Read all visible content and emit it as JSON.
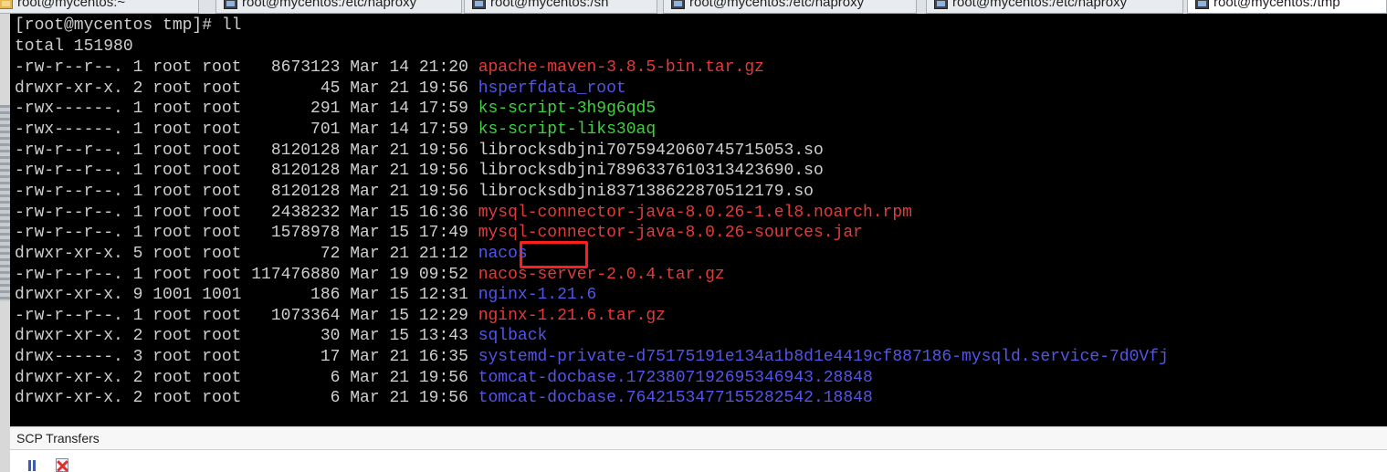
{
  "tabs": [
    {
      "label": "root@mycentos:~",
      "active": false,
      "icon": "folder-terminal-icon"
    },
    {
      "label": "root@mycentos:/etc/haproxy",
      "active": false,
      "icon": "terminal-icon"
    },
    {
      "label": "root@mycentos:/sh",
      "active": false,
      "icon": "terminal-icon"
    },
    {
      "label": "root@mycentos:/etc/haproxy",
      "active": false,
      "icon": "terminal-icon"
    },
    {
      "label": "root@mycentos:/etc/haproxy",
      "active": false,
      "icon": "terminal-icon"
    },
    {
      "label": "root@mycentos:/tmp",
      "active": true,
      "icon": "terminal-icon"
    }
  ],
  "terminal": {
    "prompt": "[root@mycentos tmp]# ll",
    "total": "total 151980",
    "colors": {
      "archive": "#e23b3b",
      "dir": "#5454e8",
      "exec": "#3fd03f",
      "plain": "#cfcfcf",
      "highlight": "#ff1e1e"
    },
    "rows": [
      {
        "perm": "-rw-r--r--.",
        "links": "1",
        "owner": "root",
        "group": "root",
        "size": "8673123",
        "month": "Mar",
        "day": "14",
        "time": "21:20",
        "name": "apache-maven-3.8.5-bin.tar.gz",
        "kind": "archive"
      },
      {
        "perm": "drwxr-xr-x.",
        "links": "2",
        "owner": "root",
        "group": "root",
        "size": "45",
        "month": "Mar",
        "day": "21",
        "time": "19:56",
        "name": "hsperfdata_root",
        "kind": "dir"
      },
      {
        "perm": "-rwx------.",
        "links": "1",
        "owner": "root",
        "group": "root",
        "size": "291",
        "month": "Mar",
        "day": "14",
        "time": "17:59",
        "name": "ks-script-3h9g6qd5",
        "kind": "exec"
      },
      {
        "perm": "-rwx------.",
        "links": "1",
        "owner": "root",
        "group": "root",
        "size": "701",
        "month": "Mar",
        "day": "14",
        "time": "17:59",
        "name": "ks-script-liks30aq",
        "kind": "exec"
      },
      {
        "perm": "-rw-r--r--.",
        "links": "1",
        "owner": "root",
        "group": "root",
        "size": "8120128",
        "month": "Mar",
        "day": "21",
        "time": "19:56",
        "name": "librocksdbjni7075942060745715053.so",
        "kind": "plain"
      },
      {
        "perm": "-rw-r--r--.",
        "links": "1",
        "owner": "root",
        "group": "root",
        "size": "8120128",
        "month": "Mar",
        "day": "21",
        "time": "19:56",
        "name": "librocksdbjni7896337610313423690.so",
        "kind": "plain"
      },
      {
        "perm": "-rw-r--r--.",
        "links": "1",
        "owner": "root",
        "group": "root",
        "size": "8120128",
        "month": "Mar",
        "day": "21",
        "time": "19:56",
        "name": "librocksdbjni837138622870512179.so",
        "kind": "plain"
      },
      {
        "perm": "-rw-r--r--.",
        "links": "1",
        "owner": "root",
        "group": "root",
        "size": "2438232",
        "month": "Mar",
        "day": "15",
        "time": "16:36",
        "name": "mysql-connector-java-8.0.26-1.el8.noarch.rpm",
        "kind": "archive"
      },
      {
        "perm": "-rw-r--r--.",
        "links": "1",
        "owner": "root",
        "group": "root",
        "size": "1578978",
        "month": "Mar",
        "day": "15",
        "time": "17:49",
        "name": "mysql-connector-java-8.0.26-sources.jar",
        "kind": "archive"
      },
      {
        "perm": "drwxr-xr-x.",
        "links": "5",
        "owner": "root",
        "group": "root",
        "size": "72",
        "month": "Mar",
        "day": "21",
        "time": "21:12",
        "name": "nacos",
        "kind": "dir",
        "highlighted": true
      },
      {
        "perm": "-rw-r--r--.",
        "links": "1",
        "owner": "root",
        "group": "root",
        "size": "117476880",
        "month": "Mar",
        "day": "19",
        "time": "09:52",
        "name": "nacos-server-2.0.4.tar.gz",
        "kind": "archive"
      },
      {
        "perm": "drwxr-xr-x.",
        "links": "9",
        "owner": "1001",
        "group": "1001",
        "size": "186",
        "month": "Mar",
        "day": "15",
        "time": "12:31",
        "name": "nginx-1.21.6",
        "kind": "dir"
      },
      {
        "perm": "-rw-r--r--.",
        "links": "1",
        "owner": "root",
        "group": "root",
        "size": "1073364",
        "month": "Mar",
        "day": "15",
        "time": "12:29",
        "name": "nginx-1.21.6.tar.gz",
        "kind": "archive"
      },
      {
        "perm": "drwxr-xr-x.",
        "links": "2",
        "owner": "root",
        "group": "root",
        "size": "30",
        "month": "Mar",
        "day": "15",
        "time": "13:43",
        "name": "sqlback",
        "kind": "dir"
      },
      {
        "perm": "drwx------.",
        "links": "3",
        "owner": "root",
        "group": "root",
        "size": "17",
        "month": "Mar",
        "day": "21",
        "time": "16:35",
        "name": "systemd-private-d75175191e134a1b8d1e4419cf887186-mysqld.service-7d0Vfj",
        "kind": "dir"
      },
      {
        "perm": "drwxr-xr-x.",
        "links": "2",
        "owner": "root",
        "group": "root",
        "size": "6",
        "month": "Mar",
        "day": "21",
        "time": "19:56",
        "name": "tomcat-docbase.1723807192695346943.28848",
        "kind": "dir"
      },
      {
        "perm": "drwxr-xr-x.",
        "links": "2",
        "owner": "root",
        "group": "root",
        "size": "6",
        "month": "Mar",
        "day": "21",
        "time": "19:56",
        "name": "tomcat-docbase.7642153477155282542.18848",
        "kind": "dir"
      }
    ]
  },
  "scp": {
    "title": "SCP Transfers",
    "tools": [
      {
        "name": "pause-transfers",
        "icon": "pause-icon"
      },
      {
        "name": "cancel-transfers",
        "icon": "cancel-icon"
      }
    ]
  }
}
